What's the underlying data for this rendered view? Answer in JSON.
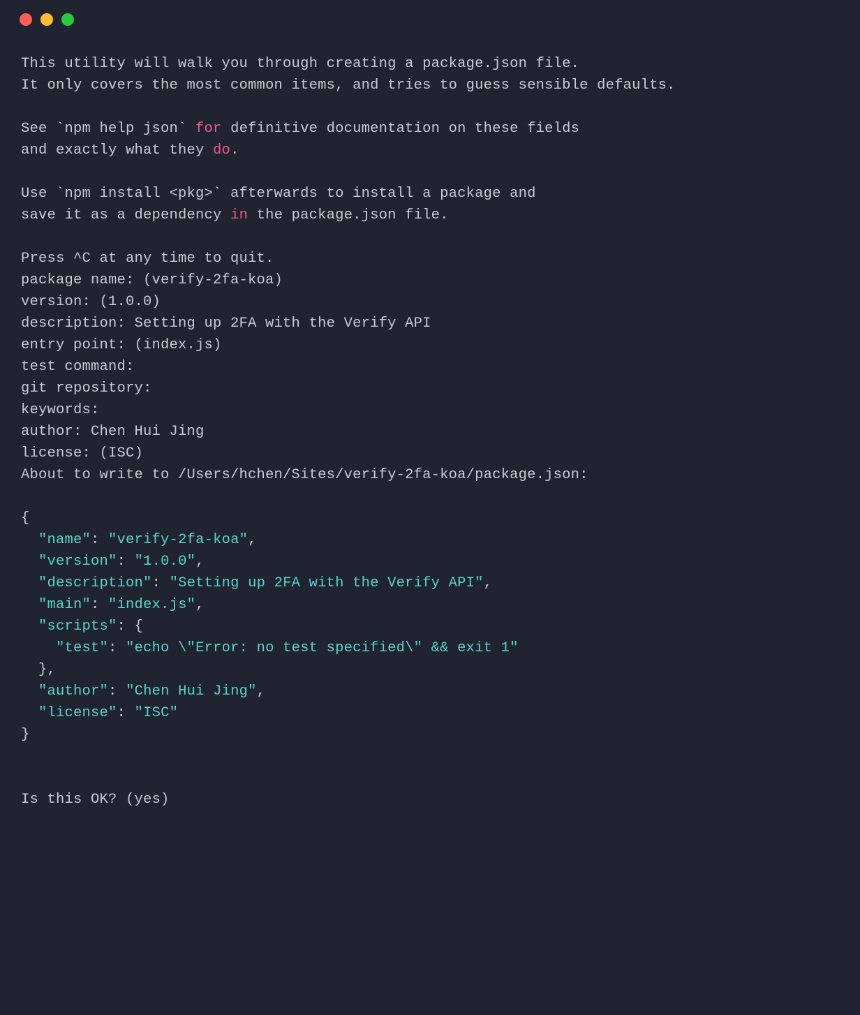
{
  "colors": {
    "bg": "#1f2430",
    "fg": "#c7cbd3",
    "keyword": "#f0578c",
    "string": "#59d3c8",
    "traffic_close": "#ff5f57",
    "traffic_min": "#febc2e",
    "traffic_max": "#28c840"
  },
  "intro": {
    "line1": "This utility will walk you through creating a package.json file.",
    "line2": "It only covers the most common items, and tries to guess sensible defaults.",
    "see_pre": "See `npm help json` ",
    "kw_for": "for",
    "see_post": " definitive documentation on these fields",
    "and_pre": "and exactly what they ",
    "kw_do": "do",
    "and_post": ".",
    "use_line": "Use `npm install <pkg>` afterwards to install a package and",
    "save_pre": "save it as a dependency ",
    "kw_in": "in",
    "save_post": " the package.json file.",
    "press": "Press ^C at any time to quit."
  },
  "prompts": {
    "package_name": "package name: (verify-2fa-koa)",
    "version": "version: (1.0.0)",
    "description": "description: Setting up 2FA with the Verify API",
    "entry_point": "entry point: (index.js)",
    "test_command": "test command:",
    "git_repository": "git repository:",
    "keywords": "keywords:",
    "author": "author: Chen Hui Jing",
    "license": "license: (ISC)",
    "about_to_write": "About to write to /Users/hchen/Sites/verify-2fa-koa/package.json:"
  },
  "package_json_preview": {
    "open": "{",
    "name_k": "\"name\"",
    "name_v": "\"verify-2fa-koa\"",
    "ver_k": "\"version\"",
    "ver_v": "\"1.0.0\"",
    "desc_k": "\"description\"",
    "desc_v": "\"Setting up 2FA with the Verify API\"",
    "main_k": "\"main\"",
    "main_v": "\"index.js\"",
    "scripts_k": "\"scripts\"",
    "test_k": "\"test\"",
    "test_v": "\"echo \\\"Error: no test specified\\\" && exit 1\"",
    "auth_k": "\"author\"",
    "auth_v": "\"Chen Hui Jing\"",
    "lic_k": "\"license\"",
    "lic_v": "\"ISC\"",
    "close": "}"
  },
  "confirm": "Is this OK? (yes)"
}
